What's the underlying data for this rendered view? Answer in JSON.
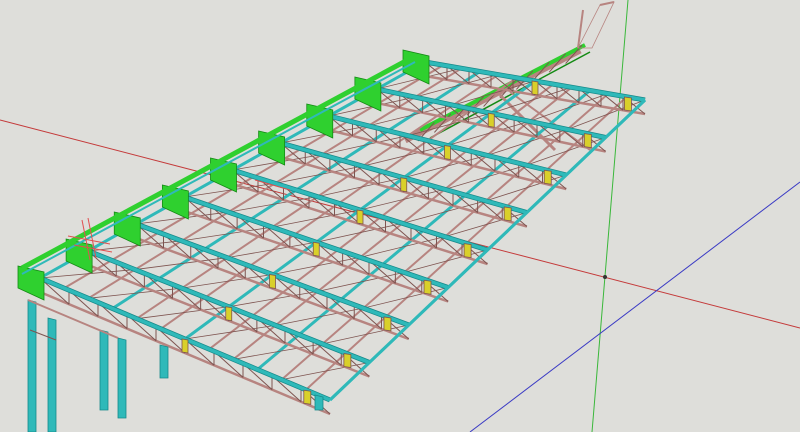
{
  "viewport": {
    "background": "#dededa",
    "colors": {
      "axis_red": "#c43a3a",
      "axis_green": "#3ab83a",
      "axis_blue": "#3a3ac4",
      "member_cyan": "#2fb9b9",
      "member_cyan_edge": "#168a8a",
      "truss_brown": "#b78480",
      "truss_dark": "#7e5450",
      "plate_green": "#2fd02f",
      "plate_green_edge": "#148a14",
      "plate_yellow": "#d9d02a"
    }
  },
  "model": {
    "frame_count": 9
  }
}
